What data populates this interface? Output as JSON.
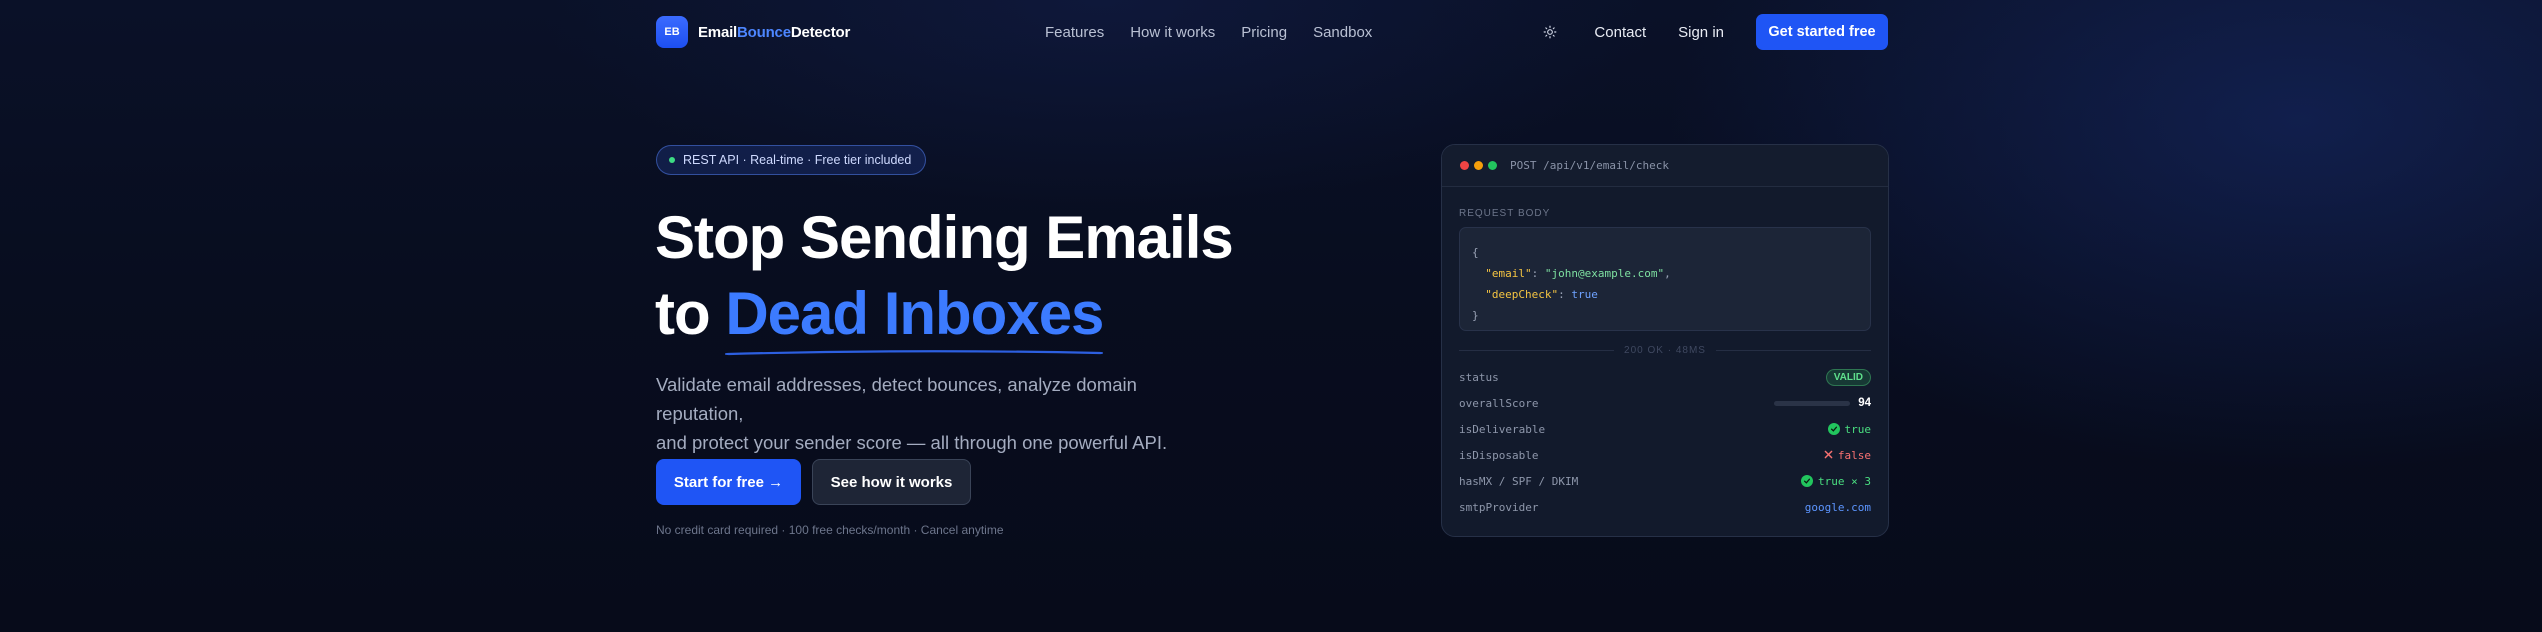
{
  "brand": {
    "badge": "EB",
    "name_part1": "Email",
    "name_part2": "Bounce",
    "name_part3": "Detector",
    "accent_color": "#1f55f5"
  },
  "nav": {
    "links": [
      "Features",
      "How it works",
      "Pricing",
      "Sandbox"
    ],
    "theme_icon": "sun-icon",
    "contact": "Contact",
    "sign_in": "Sign in",
    "cta": "Get started free"
  },
  "hero": {
    "pill": "REST API · Real-time · Free tier included",
    "title_line1": "Stop Sending Emails",
    "title_line2_prefix": "to ",
    "title_line2_highlight": "Dead Inboxes",
    "subtitle_line1": "Validate email addresses, detect bounces, analyze domain reputation,",
    "subtitle_line2": "and protect your sender score — all through one powerful API.",
    "primary_button": "Start for free →",
    "secondary_button": "See how it works",
    "fineprint": "No credit card required · 100 free checks/month · Cancel anytime"
  },
  "api_card": {
    "endpoint": "POST /api/v1/email/check",
    "request_label": "REQUEST BODY",
    "code": {
      "open": "{",
      "email_key": "\"email\"",
      "email_value": "\"john@example.com\"",
      "deep_key": "\"deepCheck\"",
      "deep_value": "true",
      "close": "}"
    },
    "response_divider": "200 OK · 48MS",
    "rows": {
      "status_key": "status",
      "status_value": "VALID",
      "score_key": "overallScore",
      "score_value": "94",
      "score_fraction": 0.94,
      "deliverable_key": "isDeliverable",
      "deliverable_value": "true",
      "disposable_key": "isDisposable",
      "disposable_value": "false",
      "mx_key": "hasMX / SPF / DKIM",
      "mx_value": "true × 3",
      "smtp_key": "smtpProvider",
      "smtp_value": "google.com"
    }
  }
}
